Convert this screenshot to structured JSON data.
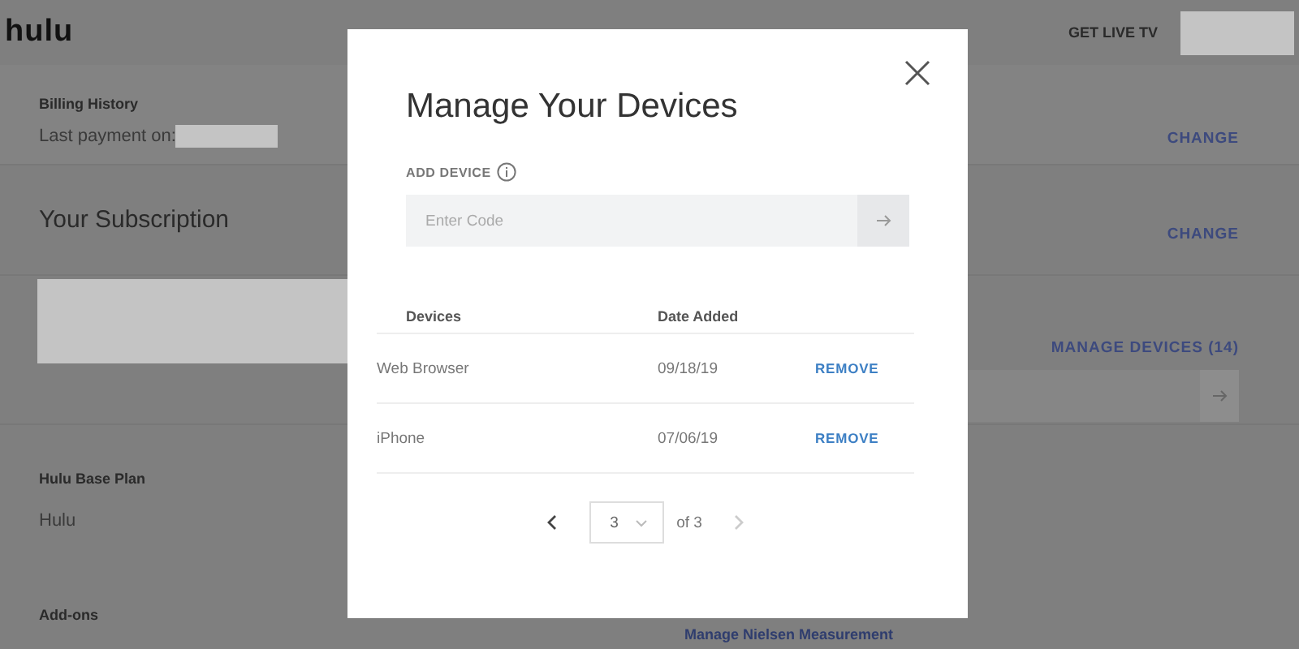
{
  "header": {
    "logo": "hulu",
    "live_tv_link": "GET LIVE TV"
  },
  "billing": {
    "title": "Billing History",
    "last_payment_label": "Last payment on:",
    "change_link": "CHANGE"
  },
  "subscription": {
    "title": "Your Subscription",
    "change_link": "CHANGE",
    "manage_devices_link": "MANAGE DEVICES (14)",
    "base_plan_label": "Hulu Base Plan",
    "base_plan_value": "Hulu",
    "addons_label": "Add-ons",
    "nielsen_link": "Manage Nielsen Measurement"
  },
  "modal": {
    "title": "Manage Your Devices",
    "add_device_label": "ADD DEVICE",
    "code_field": {
      "placeholder": "Enter Code"
    },
    "columns": [
      "Devices",
      "Date Added"
    ],
    "rows": [
      {
        "device": "Web Browser",
        "date": "09/18/19",
        "action": "REMOVE"
      },
      {
        "device": "iPhone",
        "date": "07/06/19",
        "action": "REMOVE"
      }
    ],
    "pagination": {
      "page": "3",
      "total": "of 3",
      "prev_disabled": false,
      "next_disabled": true
    }
  }
}
